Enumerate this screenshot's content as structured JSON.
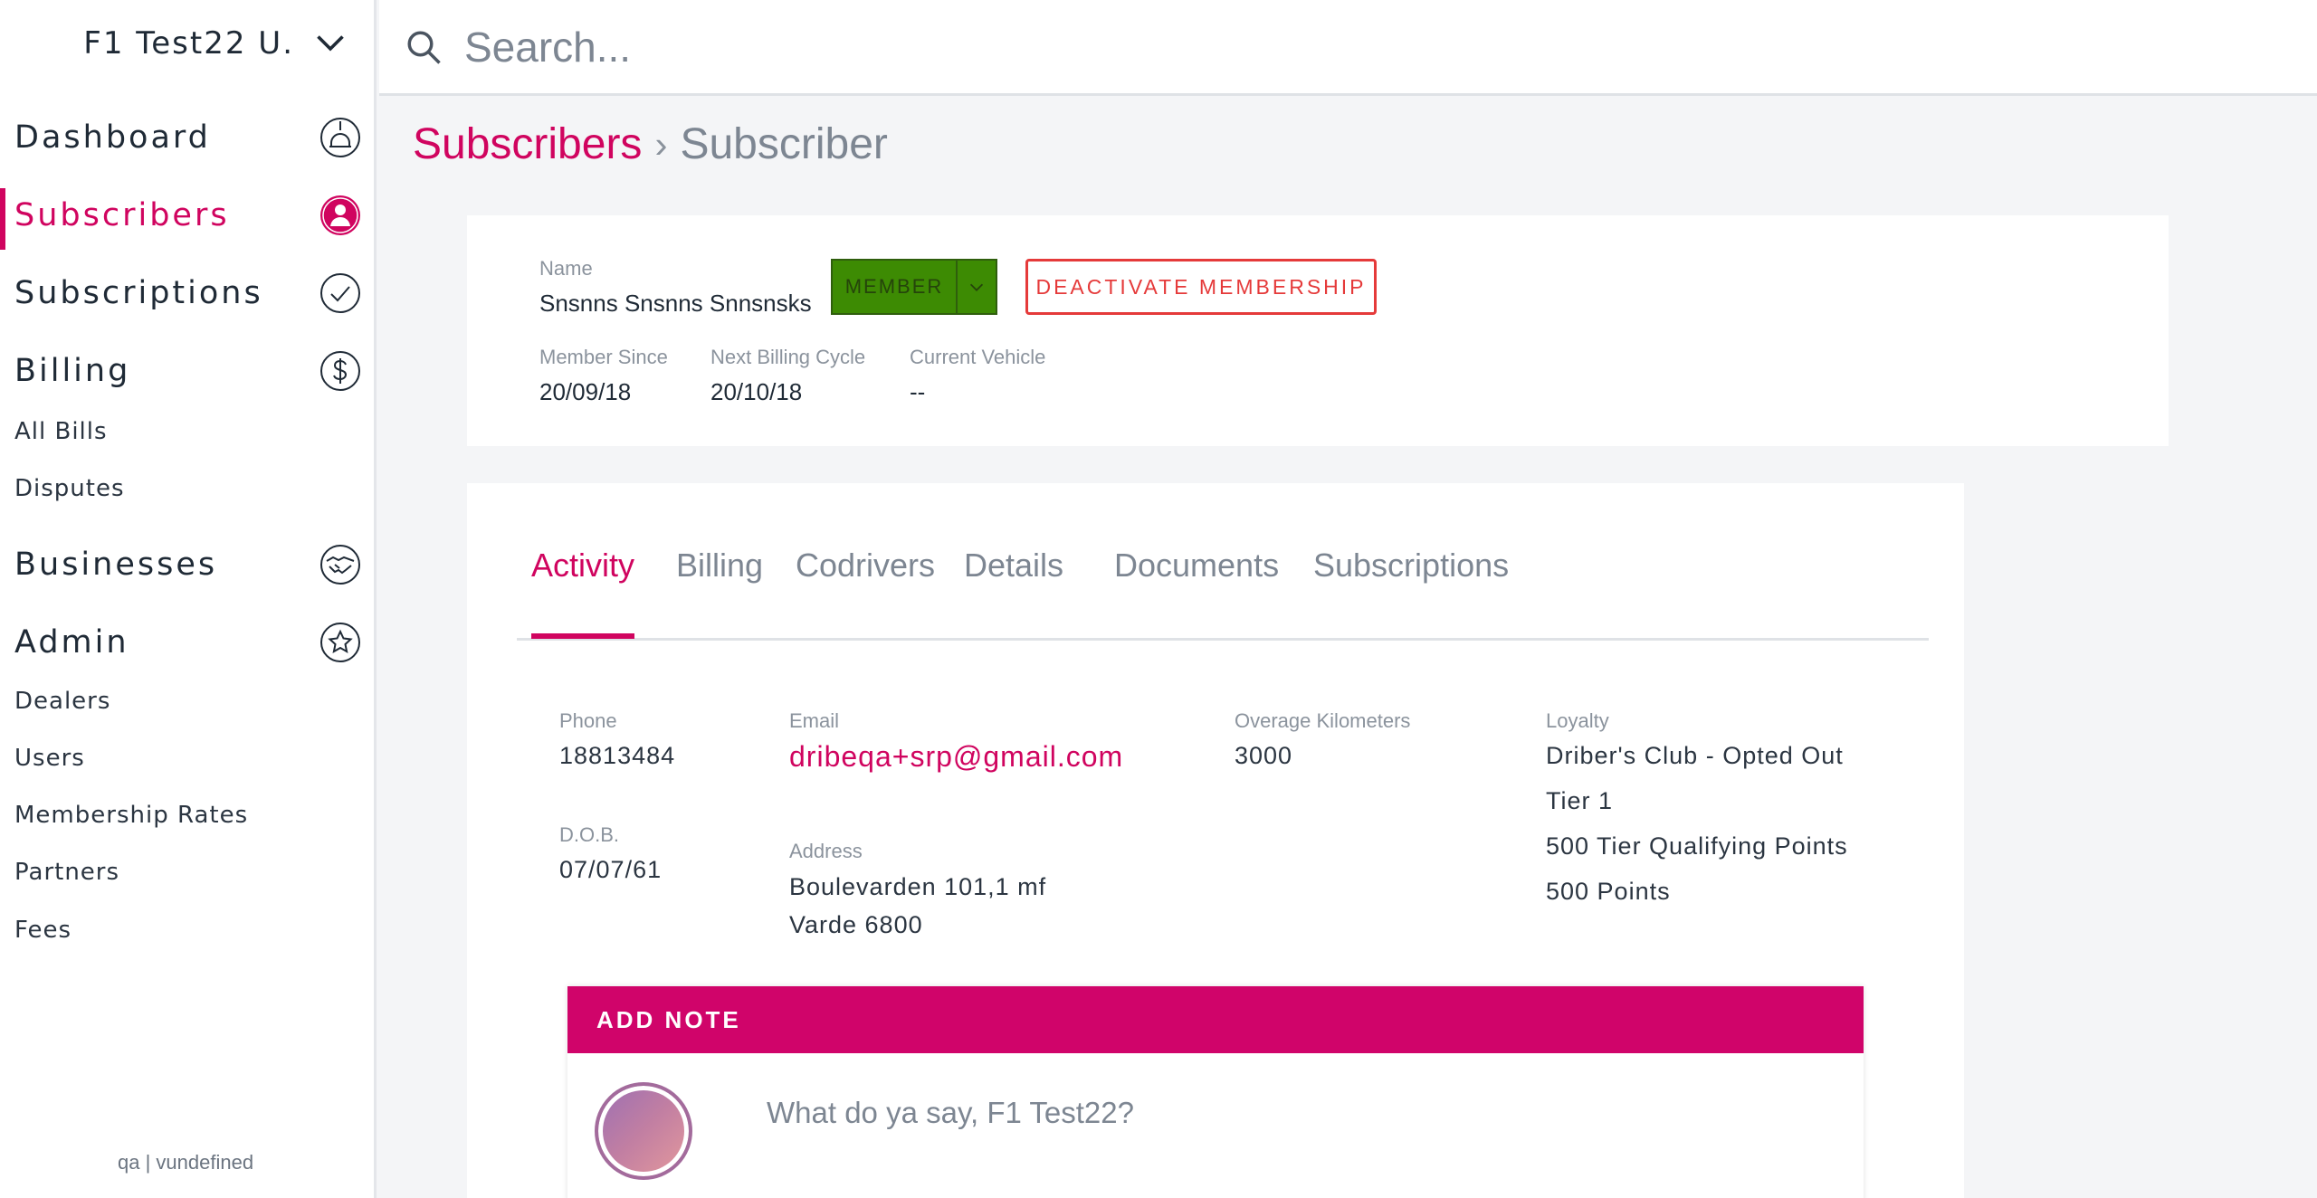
{
  "account": {
    "name": "F1 Test22 U."
  },
  "search": {
    "placeholder": "Search..."
  },
  "sidebar": {
    "main_items": [
      {
        "label": "Dashboard",
        "icon": "dashboard-icon"
      },
      {
        "label": "Subscribers",
        "icon": "user-icon",
        "active": true
      },
      {
        "label": "Subscriptions",
        "icon": "check-circle-icon"
      },
      {
        "label": "Billing",
        "icon": "dollar-icon"
      },
      {
        "label": "Businesses",
        "icon": "handshake-icon"
      },
      {
        "label": "Admin",
        "icon": "star-icon"
      }
    ],
    "billing_sub": [
      "All Bills",
      "Disputes"
    ],
    "admin_sub": [
      "Dealers",
      "Users",
      "Membership Rates",
      "Partners",
      "Fees"
    ],
    "footer": "qa | vundefined"
  },
  "breadcrumb": {
    "parent": "Subscribers",
    "separator": "›",
    "current": "Subscriber"
  },
  "subscriber": {
    "name_label": "Name",
    "name": "Snsnns Snsnns Snnsnsks",
    "status_button": "MEMBER",
    "deactivate_button": "DEACTIVATE MEMBERSHIP",
    "member_since_label": "Member Since",
    "member_since": "20/09/18",
    "next_billing_label": "Next Billing Cycle",
    "next_billing": "20/10/18",
    "vehicle_label": "Current Vehicle",
    "vehicle": "--"
  },
  "tabs": [
    "Activity",
    "Billing",
    "Codrivers",
    "Details",
    "Documents",
    "Subscriptions"
  ],
  "details": {
    "phone_label": "Phone",
    "phone": "18813484",
    "dob_label": "D.O.B.",
    "dob": "07/07/61",
    "email_label": "Email",
    "email": "dribeqa+srp@gmail.com",
    "address_label": "Address",
    "address_line1": "Boulevarden 101,1 mf",
    "address_line2": "Varde 6800",
    "overage_label": "Overage Kilometers",
    "overage": "3000",
    "loyalty_label": "Loyalty",
    "loyalty": [
      "Driber's Club - Opted Out",
      "Tier 1",
      "500 Tier Qualifying Points",
      "500 Points"
    ]
  },
  "note": {
    "header": "ADD NOTE",
    "placeholder": "What do ya say, F1 Test22?"
  },
  "colors": {
    "accent": "#d0045f",
    "member_green": "#3d8b03",
    "danger": "#e53a3a"
  }
}
